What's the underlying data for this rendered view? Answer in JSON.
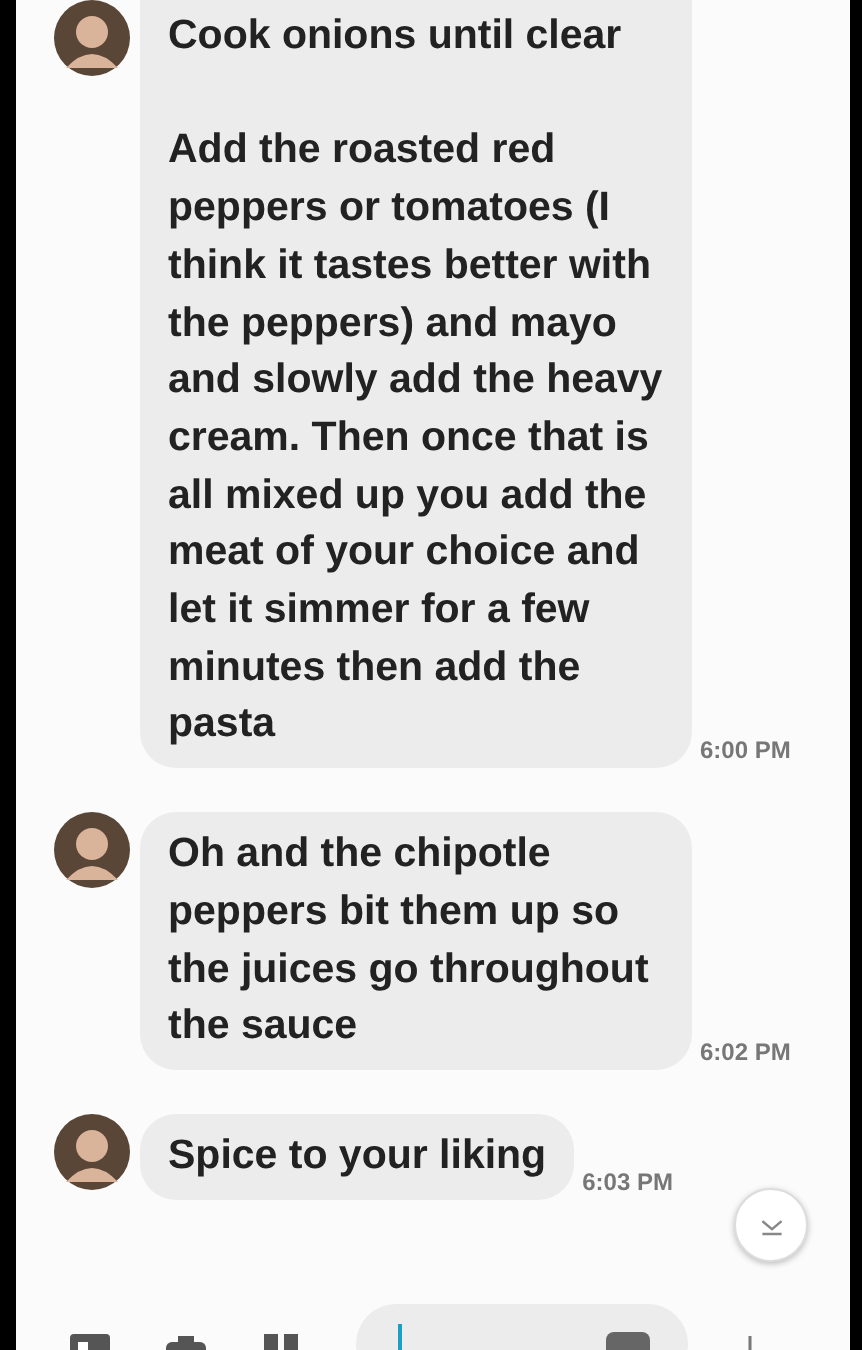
{
  "messages": [
    {
      "text": "Cook onions until clear\n\nAdd the roasted red peppers or tomatoes (I think it tastes better with the peppers) and mayo and slowly add the heavy cream. Then once that is all mixed up you add the meat of your choice and let it simmer for a few minutes then add the pasta",
      "time": "6:00 PM"
    },
    {
      "text": "Oh and the chipotle peppers bit them up so the juices go throughout the sauce",
      "time": "6:02 PM"
    },
    {
      "text": "Spice to your liking",
      "time": "6:03 PM"
    }
  ]
}
